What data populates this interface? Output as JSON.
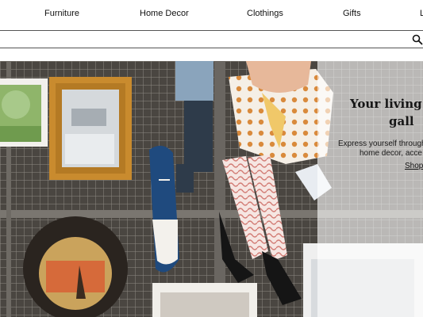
{
  "nav": {
    "items": [
      "Furniture",
      "Home Decor",
      "Clothings",
      "Gifts",
      "L"
    ]
  },
  "search": {
    "placeholder": "",
    "value": "",
    "icon": "search-icon"
  },
  "hero": {
    "title_line1": "Your living s",
    "title_line2": "gall",
    "subtitle_line1": "Express yourself through",
    "subtitle_line2": "home decor, acce",
    "link": "Shop"
  },
  "colors": {
    "frame_gold": "#c98b2e",
    "shoe_blue": "#1f4a7e",
    "polka_orange": "#d98a3c",
    "grid_gray": "#9a9690"
  }
}
